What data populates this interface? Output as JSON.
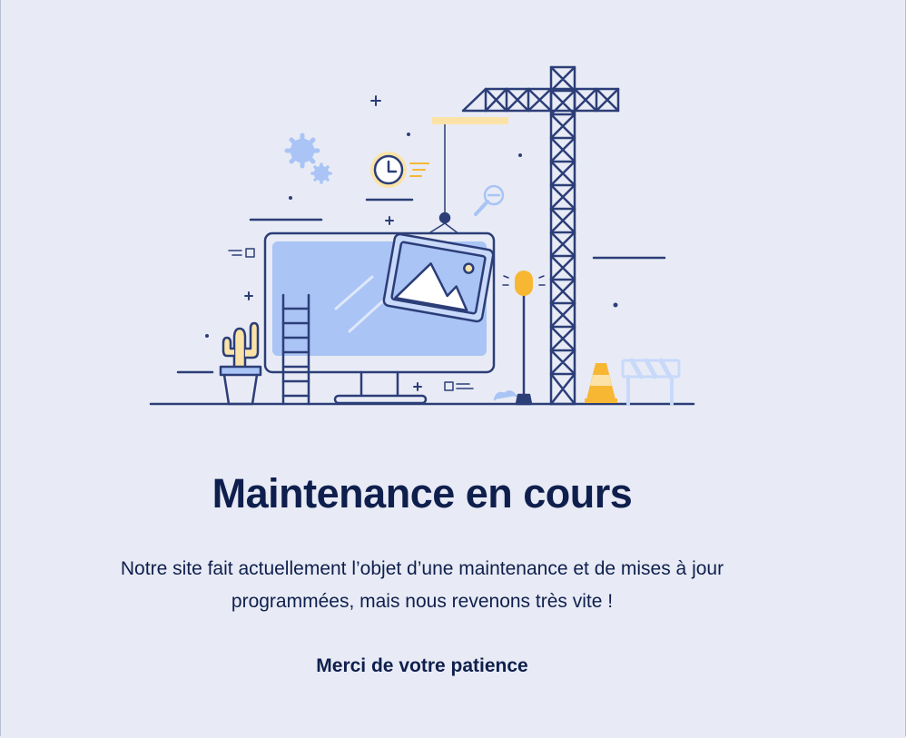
{
  "page": {
    "title": "Maintenance en cours",
    "description": "Notre site fait actuellement l’objet d’une maintenance et de mises à jour programmées, mais nous revenons très vite !",
    "thanks": "Merci de votre patience"
  },
  "illustration": {
    "icons": [
      "gears-icon",
      "clock-icon",
      "magnifier-icon",
      "monitor-icon",
      "picture-frame-icon",
      "crane-icon",
      "ladder-icon",
      "cactus-icon",
      "traffic-cone-icon",
      "barrier-icon",
      "warning-light-icon"
    ],
    "colors": {
      "navy": "#2c3e78",
      "light_blue": "#a9c4f5",
      "pale_blue": "#c8d9fa",
      "yellow": "#f7b733",
      "pale_yellow": "#fbe3a8",
      "background": "#e8ebf5"
    }
  }
}
